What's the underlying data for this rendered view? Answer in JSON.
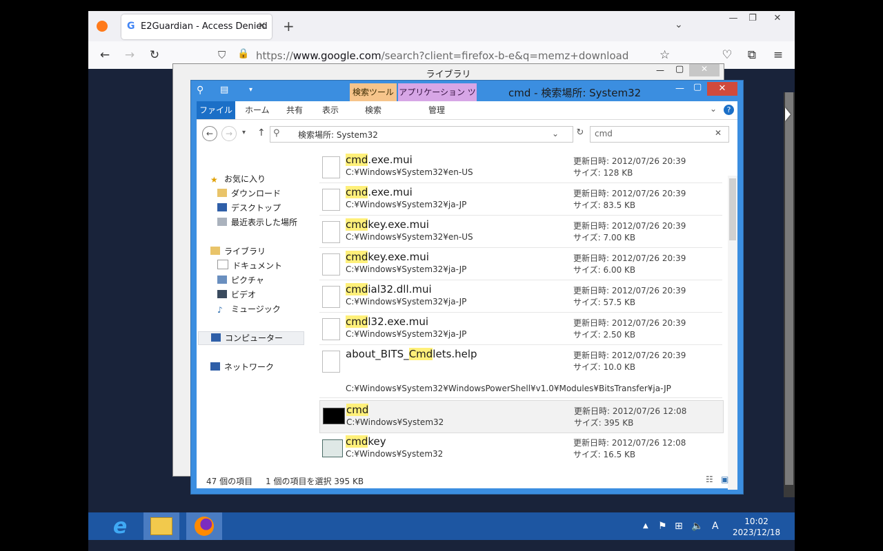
{
  "browser": {
    "tab_title": "E2Guardian - Access Denied",
    "tab_close": "×",
    "new_tab": "+",
    "url_scheme": "https://",
    "url_host": "www.google.com",
    "url_rest": "/search?client=firefox-b-e&q=memz+download",
    "win_min": "—",
    "win_max": "❐",
    "win_close": "✕"
  },
  "library_window": {
    "title": "ライブラリ"
  },
  "explorer": {
    "title": "cmd - 検索場所: System32",
    "context_tabs": {
      "search_tools": "検索ツール",
      "app_tools": "アプリケーション ツール"
    },
    "ribbon_tabs": {
      "file": "ファイル",
      "home": "ホーム",
      "share": "共有",
      "view": "表示",
      "search": "検索",
      "manage": "管理"
    },
    "address": "検索場所: System32",
    "search_value": "cmd",
    "nav": {
      "favorites": "お気に入り",
      "downloads": "ダウンロード",
      "desktop": "デスクトップ",
      "recent": "最近表示した場所",
      "libraries": "ライブラリ",
      "documents": "ドキュメント",
      "pictures": "ピクチャ",
      "videos": "ビデオ",
      "music": "ミュージック",
      "computer": "コンピューター",
      "network": "ネットワーク"
    },
    "results": [
      {
        "hl": "cmd",
        "rest": ".exe.mui",
        "path": "C:¥Windows¥System32¥en-US",
        "date": "更新日時: 2012/07/26 20:39",
        "size": "サイズ: 128 KB"
      },
      {
        "hl": "cmd",
        "rest": ".exe.mui",
        "path": "C:¥Windows¥System32¥ja-JP",
        "date": "更新日時: 2012/07/26 20:39",
        "size": "サイズ: 83.5 KB"
      },
      {
        "hl": "cmd",
        "rest": "key.exe.mui",
        "path": "C:¥Windows¥System32¥en-US",
        "date": "更新日時: 2012/07/26 20:39",
        "size": "サイズ: 7.00 KB"
      },
      {
        "hl": "cmd",
        "rest": "key.exe.mui",
        "path": "C:¥Windows¥System32¥ja-JP",
        "date": "更新日時: 2012/07/26 20:39",
        "size": "サイズ: 6.00 KB"
      },
      {
        "hl": "cmd",
        "rest": "ial32.dll.mui",
        "path": "C:¥Windows¥System32¥ja-JP",
        "date": "更新日時: 2012/07/26 20:39",
        "size": "サイズ: 57.5 KB"
      },
      {
        "hl": "cmd",
        "rest": "l32.exe.mui",
        "path": "C:¥Windows¥System32¥ja-JP",
        "date": "更新日時: 2012/07/26 20:39",
        "size": "サイズ: 2.50 KB"
      }
    ],
    "bits": {
      "pre": "about_BITS_",
      "hl": "Cmd",
      "post": "lets.help",
      "path": "C:¥Windows¥System32¥WindowsPowerShell¥v1.0¥Modules¥BitsTransfer¥ja-JP",
      "date": "更新日時: 2012/07/26 20:39",
      "size": "サイズ: 10.0 KB"
    },
    "cmd_row": {
      "hl": "cmd",
      "path": "C:¥Windows¥System32",
      "date": "更新日時: 2012/07/26 12:08",
      "size": "サイズ: 395 KB"
    },
    "cmdkey_row": {
      "hl": "cmd",
      "rest": "key",
      "path": "C:¥Windows¥System32",
      "date": "更新日時: 2012/07/26 12:08",
      "size": "サイズ: 16.5 KB"
    },
    "status_count": "47 個の項目",
    "status_selected": "1 個の項目を選択  395 KB"
  },
  "taskbar": {
    "time": "10:02",
    "date": "2023/12/18",
    "ime": "A"
  }
}
